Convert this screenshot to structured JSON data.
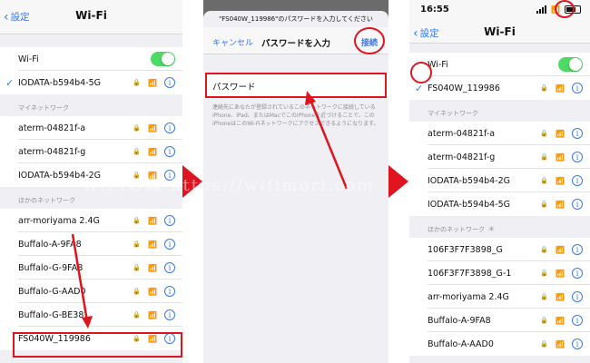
{
  "colors": {
    "accent": "#3478f6",
    "toggle_on": "#4cd964",
    "highlight": "#e0141e"
  },
  "panel1": {
    "back_label": "設定",
    "title": "Wi-Fi",
    "wifi_label": "Wi-Fi",
    "connected_network": "IODATA-b594b4-5G",
    "my_networks_header": "マイネットワーク",
    "my_networks": [
      "aterm-04821f-a",
      "aterm-04821f-g",
      "IODATA-b594b4-2G"
    ],
    "other_header": "ほかのネットワーク",
    "other_networks": [
      "arr-moriyama 2.4G",
      "Buffalo-A-9FA8",
      "Buffalo-G-9FA8",
      "Buffalo-G-AAD0",
      "Buffalo-G-BE38",
      "FS040W_119986"
    ]
  },
  "panel2": {
    "prompt": "\"FS040W_119986\"のパスワードを入力してください",
    "cancel": "キャンセル",
    "title": "パスワードを入力",
    "join": "接続",
    "password_label": "パスワード",
    "note": "連絡先にあなたが登録されているこのネットワークに接続しているiPhone、iPad、またはMacでこのiPhoneを近づけることで、このiPhoneはこのWi-Fiネットワークにアクセスできるようになります。"
  },
  "panel3": {
    "time": "16:55",
    "back_label": "設定",
    "title": "Wi-Fi",
    "wifi_label": "Wi-Fi",
    "connected_network": "FS040W_119986",
    "my_networks_header": "マイネットワーク",
    "my_networks": [
      "aterm-04821f-a",
      "aterm-04821f-g",
      "IODATA-b594b4-2G",
      "IODATA-b594b4-5G"
    ],
    "other_header": "ほかのネットワーク",
    "other_networks": [
      "106F3F7F3898_G",
      "106F3F7F3898_G-1",
      "arr-moriyama 2.4G",
      "Buffalo-A-9FA8",
      "Buffalo-A-AAD0"
    ]
  },
  "watermark": "WiFiの森 https://wifimori.com"
}
